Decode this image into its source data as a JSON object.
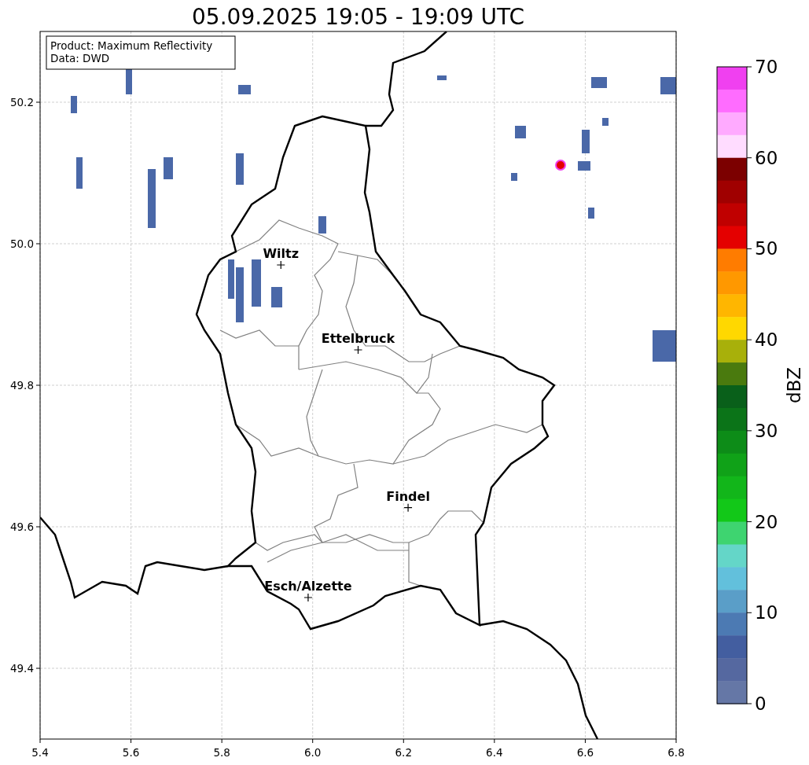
{
  "chart_data": {
    "type": "scatter",
    "title": "05.09.2025 19:05 - 19:09 UTC",
    "xlim": [
      5.4,
      6.8
    ],
    "ylim": [
      49.3,
      50.3
    ],
    "xticks": [
      {
        "value": 5.4,
        "label": "5.4"
      },
      {
        "value": 5.6,
        "label": "5.6"
      },
      {
        "value": 5.8,
        "label": "5.8"
      },
      {
        "value": 6.0,
        "label": "6.0"
      },
      {
        "value": 6.2,
        "label": "6.2"
      },
      {
        "value": 6.4,
        "label": "6.4"
      },
      {
        "value": 6.6,
        "label": "6.6"
      },
      {
        "value": 6.8,
        "label": "6.8"
      }
    ],
    "yticks": [
      {
        "value": 49.4,
        "label": "49.4"
      },
      {
        "value": 49.6,
        "label": "49.6"
      },
      {
        "value": 49.8,
        "label": "49.8"
      },
      {
        "value": 50.0,
        "label": "50.0"
      },
      {
        "value": 50.2,
        "label": "50.2"
      }
    ],
    "x": [
      5.93,
      6.1,
      6.21,
      5.99
    ],
    "grid": true,
    "series": [
      {
        "color": "#000000",
        "values": [
          49.97,
          49.85,
          49.627,
          49.5
        ]
      }
    ],
    "annotations": [
      {
        "text": "Wiltz",
        "x": 5.93,
        "y": 49.97
      },
      {
        "text": "Ettelbruck",
        "x": 6.1,
        "y": 49.85
      },
      {
        "text": "Findel",
        "x": 6.21,
        "y": 49.627
      },
      {
        "text": "Esch/Alzette",
        "x": 5.99,
        "y": 49.5
      }
    ]
  },
  "legend": [
    "Product: Maximum Reflectivity",
    "Data: DWD"
  ],
  "colorbar": {
    "label": "dBZ",
    "ticks": [
      "70",
      "60",
      "50",
      "40",
      "30",
      "20",
      "10",
      "0"
    ],
    "bins": [
      {
        "color": "#f040f0"
      },
      {
        "color": "#ff6cff"
      },
      {
        "color": "#ffaaff"
      },
      {
        "color": "#ffdcff"
      },
      {
        "color": "#7c0000"
      },
      {
        "color": "#a00000"
      },
      {
        "color": "#c00000"
      },
      {
        "color": "#e40000"
      },
      {
        "color": "#ff7c00"
      },
      {
        "color": "#ff9800"
      },
      {
        "color": "#ffb600"
      },
      {
        "color": "#ffd800"
      },
      {
        "color": "#a8b00a"
      },
      {
        "color": "#4a7a0e"
      },
      {
        "color": "#09601a"
      },
      {
        "color": "#0b7418"
      },
      {
        "color": "#0d8c18"
      },
      {
        "color": "#10a218"
      },
      {
        "color": "#12b61a"
      },
      {
        "color": "#12c818"
      },
      {
        "color": "#3ed470"
      },
      {
        "color": "#64d6c8"
      },
      {
        "color": "#62c0dc"
      },
      {
        "color": "#5a9ec8"
      },
      {
        "color": "#4c7ab3"
      },
      {
        "color": "#435ea0"
      },
      {
        "color": "#5568a0"
      },
      {
        "color": "#6577a6"
      }
    ]
  }
}
